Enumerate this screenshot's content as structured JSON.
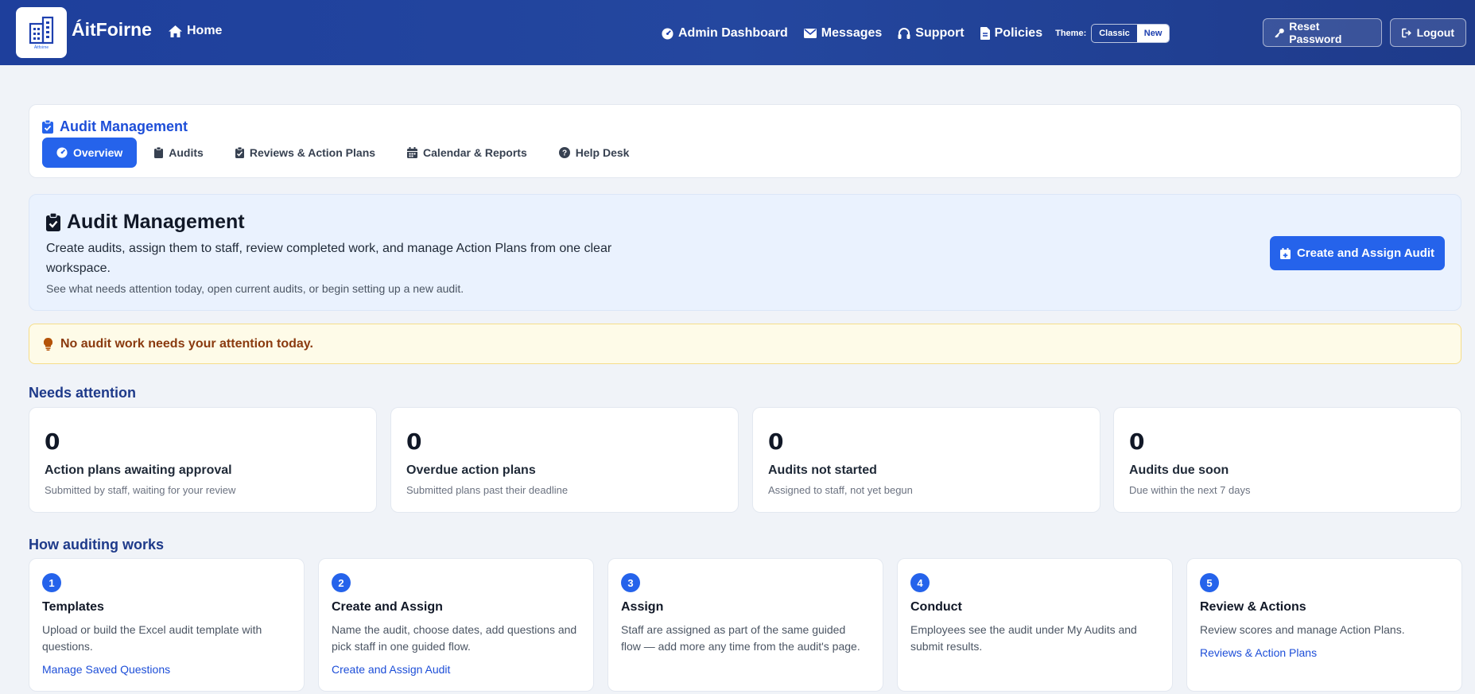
{
  "header": {
    "brand": "ÁitFoirne",
    "logo_caption": "Áitfoirne",
    "home": "Home",
    "nav": [
      "Admin Dashboard",
      "Messages",
      "Support",
      "Policies"
    ],
    "theme_label": "Theme:",
    "theme_options": [
      "Classic",
      "New"
    ],
    "theme_selected": "New",
    "reset_password": "Reset Password",
    "logout": "Logout"
  },
  "section_nav": {
    "title": "Audit Management",
    "tabs": [
      "Overview",
      "Audits",
      "Reviews & Action Plans",
      "Calendar & Reports",
      "Help Desk"
    ],
    "active_tab": "Overview"
  },
  "hero": {
    "title": "Audit Management",
    "description": "Create audits, assign them to staff, review completed work, and manage Action Plans from one clear workspace.",
    "subtext": "See what needs attention today, open current audits, or begin setting up a new audit.",
    "cta": "Create and Assign Audit"
  },
  "alert": {
    "text": "No audit work needs your attention today."
  },
  "needs_attention": {
    "title": "Needs attention",
    "stats": [
      {
        "value": "0",
        "label": "Action plans awaiting approval",
        "hint": "Submitted by staff, waiting for your review"
      },
      {
        "value": "0",
        "label": "Overdue action plans",
        "hint": "Submitted plans past their deadline"
      },
      {
        "value": "0",
        "label": "Audits not started",
        "hint": "Assigned to staff, not yet begun"
      },
      {
        "value": "0",
        "label": "Audits due soon",
        "hint": "Due within the next 7 days"
      }
    ]
  },
  "how_it_works": {
    "title": "How auditing works",
    "steps": [
      {
        "num": "1",
        "title": "Templates",
        "desc": "Upload or build the Excel audit template with questions.",
        "link": "Manage Saved Questions"
      },
      {
        "num": "2",
        "title": "Create and Assign",
        "desc": "Name the audit, choose dates, add questions and pick staff in one guided flow.",
        "link": "Create and Assign Audit"
      },
      {
        "num": "3",
        "title": "Assign",
        "desc": "Staff are assigned as part of the same guided flow — add more any time from the audit's page.",
        "link": ""
      },
      {
        "num": "4",
        "title": "Conduct",
        "desc": "Employees see the audit under My Audits and submit results.",
        "link": ""
      },
      {
        "num": "5",
        "title": "Review & Actions",
        "desc": "Review scores and manage Action Plans.",
        "link": "Reviews & Action Plans"
      }
    ]
  },
  "colors": {
    "primary": "#2563eb",
    "header_bg": "#1e3f9c",
    "alert_bg": "#fefbe8",
    "alert_text": "#8a3a0f",
    "hero_bg": "#eaf2fe"
  }
}
